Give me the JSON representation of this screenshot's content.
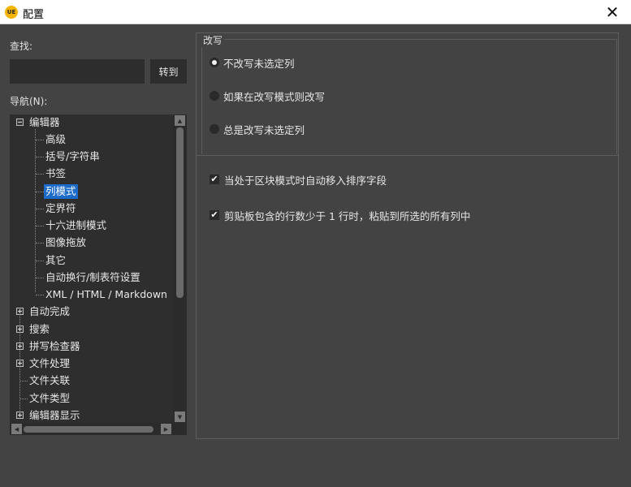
{
  "window": {
    "title": "配置",
    "app_icon_text": "UE",
    "close_glyph": "✕"
  },
  "search": {
    "label": "查找:",
    "value": "",
    "placeholder": "",
    "goto_label": "转到"
  },
  "navigation": {
    "label": "导航(N):",
    "items": [
      {
        "label": "编辑器",
        "level": 0,
        "expander": "minus"
      },
      {
        "label": "高级",
        "level": 1
      },
      {
        "label": "括号/字符串",
        "level": 1
      },
      {
        "label": "书签",
        "level": 1
      },
      {
        "label": "列模式",
        "level": 1,
        "selected": true
      },
      {
        "label": "定界符",
        "level": 1
      },
      {
        "label": "十六进制模式",
        "level": 1
      },
      {
        "label": "图像拖放",
        "level": 1
      },
      {
        "label": "其它",
        "level": 1
      },
      {
        "label": "自动换行/制表符设置",
        "level": 1
      },
      {
        "label": "XML / HTML / Markdown",
        "level": 1
      },
      {
        "label": "自动完成",
        "level": 0,
        "expander": "plus"
      },
      {
        "label": "搜索",
        "level": 0,
        "expander": "plus"
      },
      {
        "label": "拼写检查器",
        "level": 0,
        "expander": "plus"
      },
      {
        "label": "文件处理",
        "level": 0,
        "expander": "plus"
      },
      {
        "label": "文件关联",
        "level": 0
      },
      {
        "label": "文件类型",
        "level": 0
      },
      {
        "label": "编辑器显示",
        "level": 0,
        "expander": "plus"
      }
    ]
  },
  "overwrite": {
    "group_title": "改写",
    "options": [
      {
        "label": "不改写未选定列",
        "checked": true
      },
      {
        "label": "如果在改写模式则改写",
        "checked": false
      },
      {
        "label": "总是改写未选定列",
        "checked": false
      }
    ]
  },
  "options": [
    {
      "label": "当处于区块模式时自动移入排序字段",
      "checked": true
    },
    {
      "label": "剪贴板包含的行数少于 1 行时，粘贴到所选的所有列中",
      "checked": true
    }
  ],
  "colors": {
    "background": "#434343",
    "selection": "#1c6bc9",
    "tree_bg": "#2e2e2e"
  }
}
